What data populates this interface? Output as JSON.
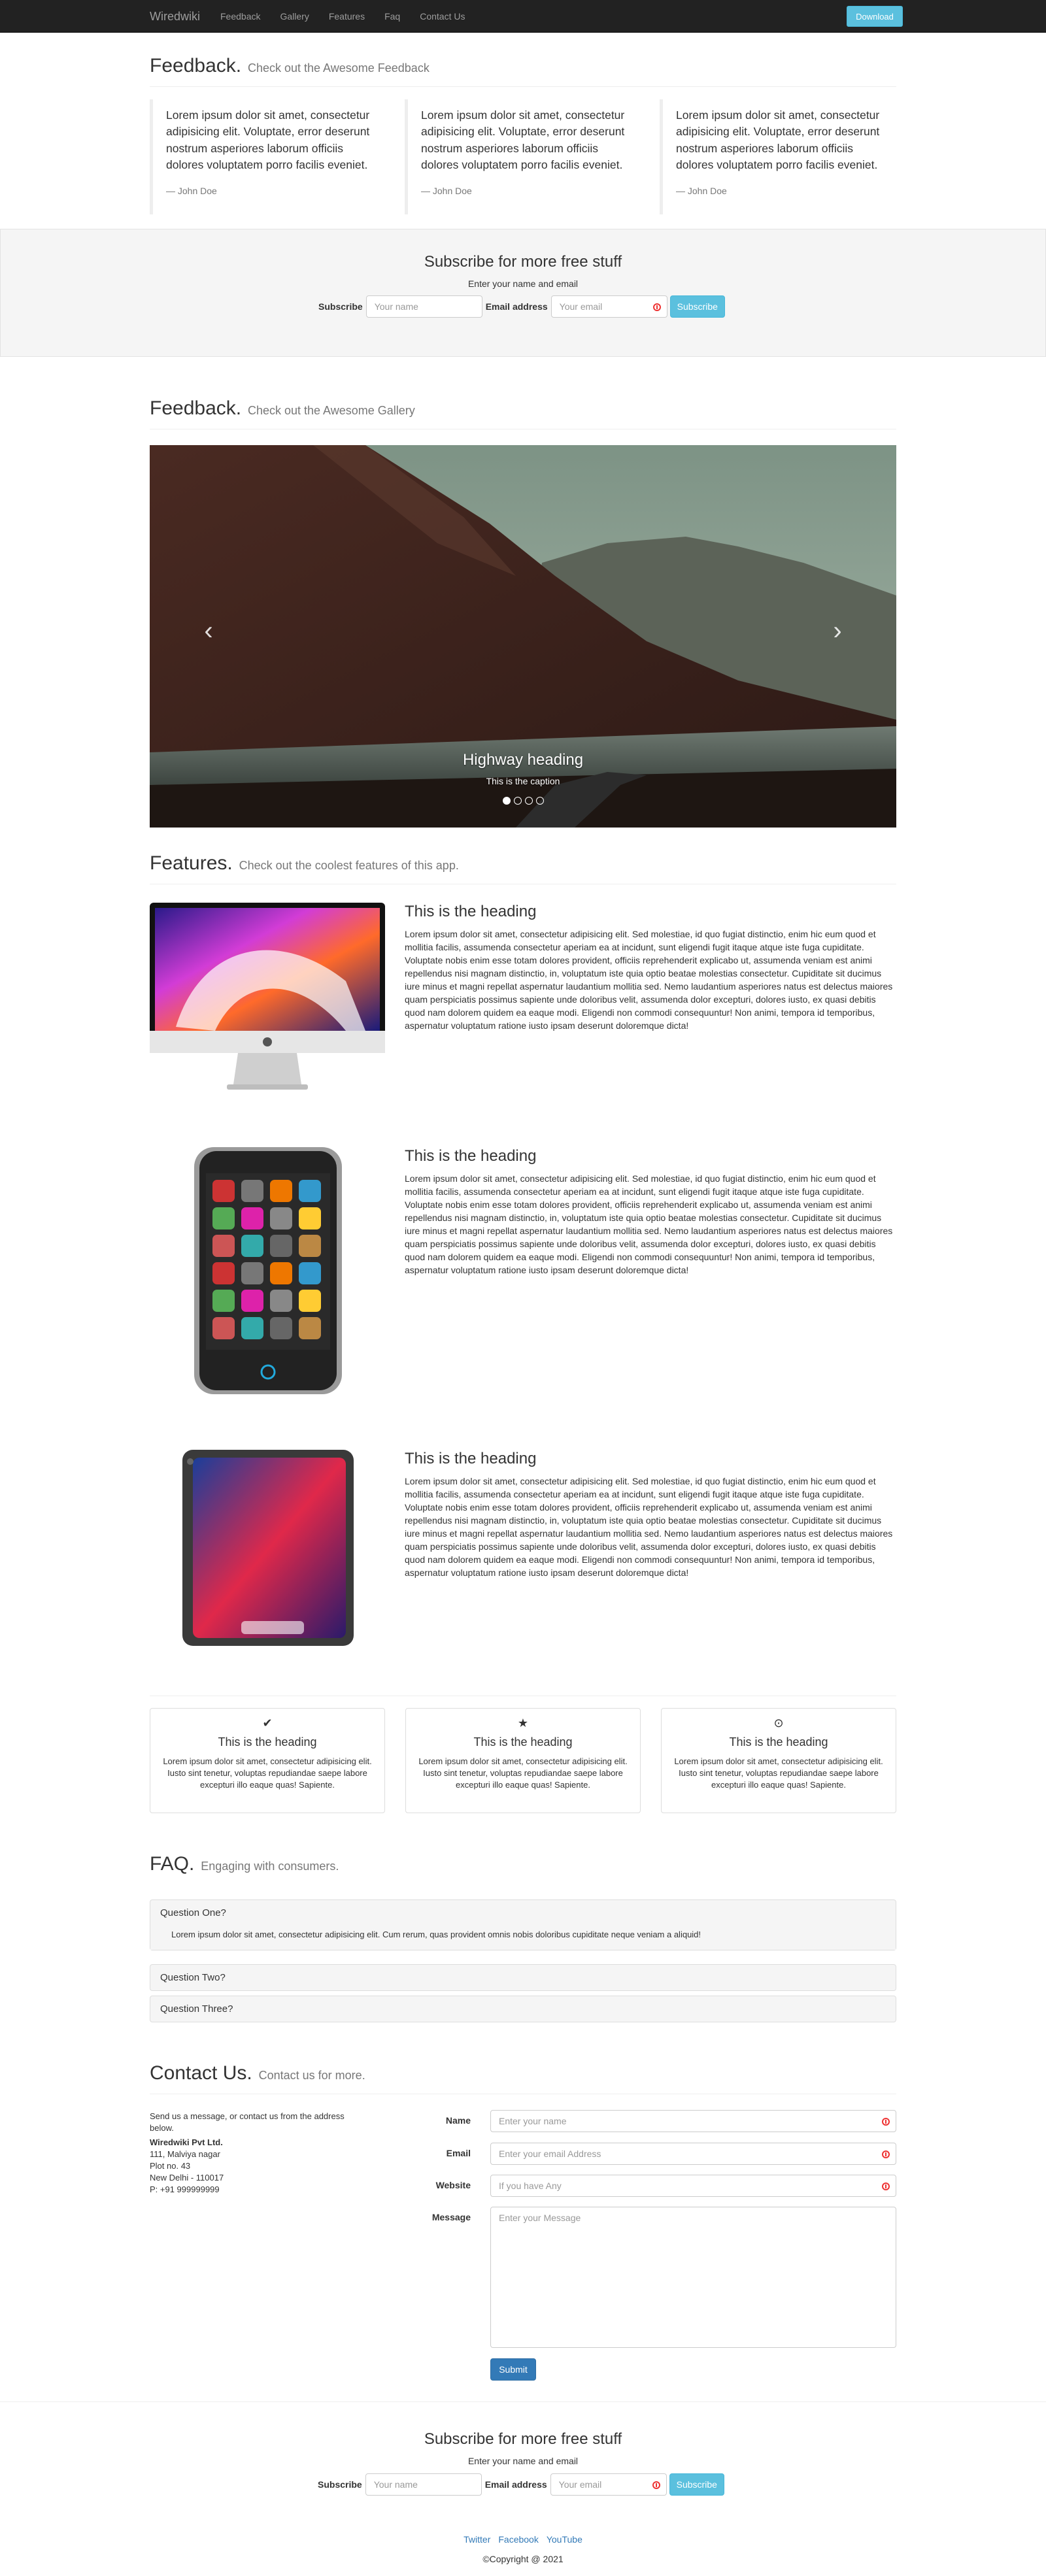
{
  "navbar": {
    "brand": "Wiredwiki",
    "links": [
      "Feedback",
      "Gallery",
      "Features",
      "Faq",
      "Contact Us"
    ],
    "download": "Download"
  },
  "feedback": {
    "title": "Feedback.",
    "subtitle": "Check out the Awesome Feedback",
    "quotes": [
      {
        "text": "Lorem ipsum dolor sit amet, consectetur adipisicing elit. Voluptate, error deserunt nostrum asperiores laborum officiis dolores voluptatem porro facilis eveniet.",
        "author": "— John Doe"
      },
      {
        "text": "Lorem ipsum dolor sit amet, consectetur adipisicing elit. Voluptate, error deserunt nostrum asperiores laborum officiis dolores voluptatem porro facilis eveniet.",
        "author": "— John Doe"
      },
      {
        "text": "Lorem ipsum dolor sit amet, consectetur adipisicing elit. Voluptate, error deserunt nostrum asperiores laborum officiis dolores voluptatem porro facilis eveniet.",
        "author": "— John Doe"
      }
    ]
  },
  "subscribe": {
    "title": "Subscribe for more free stuff",
    "note": "Enter your name and email",
    "name_label": "Subscribe",
    "name_placeholder": "Your name",
    "email_label": "Email address",
    "email_placeholder": "Your email",
    "button": "Subscribe"
  },
  "gallery": {
    "title": "Feedback.",
    "subtitle": "Check out the Awesome Gallery",
    "caption_heading": "Highway heading",
    "caption_text": "This is the caption",
    "prev": "‹",
    "next": "›",
    "slide_count": 4,
    "active_slide": 1
  },
  "features": {
    "title": "Features.",
    "subtitle": "Check out the coolest features of this app.",
    "rows": [
      {
        "heading": "This is the heading",
        "image": "imac-icon",
        "text": "Lorem ipsum dolor sit amet, consectetur adipisicing elit. Sed molestiae, id quo fugiat distinctio, enim hic eum quod et mollitia facilis, assumenda consectetur aperiam ea at incidunt, sunt eligendi fugit itaque atque iste fuga cupiditate. Voluptate nobis enim esse totam dolores provident, officiis reprehenderit explicabo ut, assumenda veniam est animi repellendus nisi magnam distinctio, in, voluptatum iste quia optio beatae molestias consectetur. Cupiditate sit ducimus iure minus et magni repellat aspernatur laudantium mollitia sed. Nemo laudantium asperiores natus est delectus maiores quam perspiciatis possimus sapiente unde doloribus velit, assumenda dolor excepturi, dolores iusto, ex quasi debitis quod nam dolorem quidem ea eaque modi. Eligendi non commodi consequuntur! Non animi, tempora id temporibus, aspernatur voluptatum ratione iusto ipsam deserunt doloremque dicta!"
      },
      {
        "heading": "This is the heading",
        "image": "phone-icon",
        "text": "Lorem ipsum dolor sit amet, consectetur adipisicing elit. Sed molestiae, id quo fugiat distinctio, enim hic eum quod et mollitia facilis, assumenda consectetur aperiam ea at incidunt, sunt eligendi fugit itaque atque iste fuga cupiditate. Voluptate nobis enim esse totam dolores provident, officiis reprehenderit explicabo ut, assumenda veniam est animi repellendus nisi magnam distinctio, in, voluptatum iste quia optio beatae molestias consectetur. Cupiditate sit ducimus iure minus et magni repellat aspernatur laudantium mollitia sed. Nemo laudantium asperiores natus est delectus maiores quam perspiciatis possimus sapiente unde doloribus velit, assumenda dolor excepturi, dolores iusto, ex quasi debitis quod nam dolorem quidem ea eaque modi. Eligendi non commodi consequuntur! Non animi, tempora id temporibus, aspernatur voluptatum ratione iusto ipsam deserunt doloremque dicta!"
      },
      {
        "heading": "This is the heading",
        "image": "tablet-icon",
        "text": "Lorem ipsum dolor sit amet, consectetur adipisicing elit. Sed molestiae, id quo fugiat distinctio, enim hic eum quod et mollitia facilis, assumenda consectetur aperiam ea at incidunt, sunt eligendi fugit itaque atque iste fuga cupiditate. Voluptate nobis enim esse totam dolores provident, officiis reprehenderit explicabo ut, assumenda veniam est animi repellendus nisi magnam distinctio, in, voluptatum iste quia optio beatae molestias consectetur. Cupiditate sit ducimus iure minus et magni repellat aspernatur laudantium mollitia sed. Nemo laudantium asperiores natus est delectus maiores quam perspiciatis possimus sapiente unde doloribus velit, assumenda dolor excepturi, dolores iusto, ex quasi debitis quod nam dolorem quidem ea eaque modi. Eligendi non commodi consequuntur! Non animi, tempora id temporibus, aspernatur voluptatum ratione iusto ipsam deserunt doloremque dicta!"
      }
    ],
    "boxes": [
      {
        "icon": "✔",
        "heading": "This is the heading",
        "text": "Lorem ipsum dolor sit amet, consectetur adipisicing elit. Iusto sint tenetur, voluptas repudiandae saepe labore excepturi illo eaque quas! Sapiente."
      },
      {
        "icon": "★",
        "heading": "This is the heading",
        "text": "Lorem ipsum dolor sit amet, consectetur adipisicing elit. Iusto sint tenetur, voluptas repudiandae saepe labore excepturi illo eaque quas! Sapiente."
      },
      {
        "icon": "⊙",
        "heading": "This is the heading",
        "text": "Lorem ipsum dolor sit amet, consectetur adipisicing elit. Iusto sint tenetur, voluptas repudiandae saepe labore excepturi illo eaque quas! Sapiente."
      }
    ]
  },
  "faq": {
    "title": "FAQ.",
    "subtitle": "Engaging with consumers.",
    "questions": [
      {
        "q": "Question One?",
        "a": "Lorem ipsum dolor sit amet, consectetur adipisicing elit. Cum rerum, quas provident omnis nobis doloribus cupiditate neque veniam a aliquid!"
      },
      {
        "q": "Question Two?"
      },
      {
        "q": "Question Three?"
      }
    ]
  },
  "contact": {
    "title": "Contact Us.",
    "subtitle": "Contact us for more.",
    "intro": "Send us a message, or contact us from the address below.",
    "company": "Wiredwiki Pvt Ltd.",
    "address_lines": [
      "111, Malviya nagar",
      "Plot no. 43",
      "New Delhi - 110017",
      "P: +91 999999999"
    ],
    "name_label": "Name",
    "name_placeholder": "Enter your name",
    "email_label": "Email",
    "email_placeholder": "Enter your email Address",
    "website_label": "Website",
    "website_placeholder": "If you have Any",
    "message_label": "Message",
    "message_placeholder": "Enter your Message",
    "submit": "Submit"
  },
  "footer": {
    "links": [
      "Twitter",
      "Facebook",
      "YouTube"
    ],
    "copyright": "©Copyright @ 2021"
  }
}
